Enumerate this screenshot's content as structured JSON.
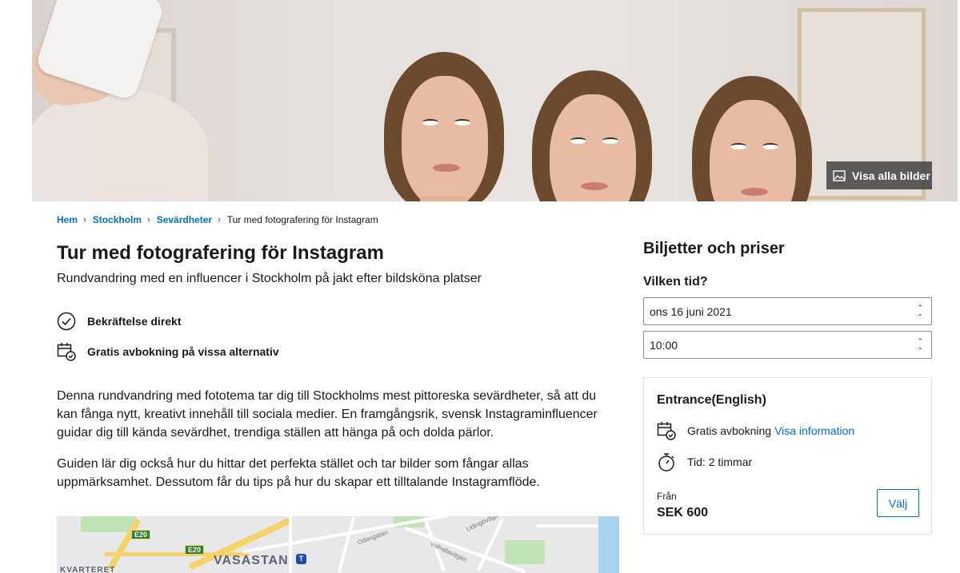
{
  "hero": {
    "view_all_label": "Visa alla bilder"
  },
  "breadcrumb": {
    "items": [
      "Hem",
      "Stockholm",
      "Sevärdheter"
    ],
    "current": "Tur med fotografering för Instagram"
  },
  "attraction": {
    "title": "Tur med fotografering för Instagram",
    "subtitle": "Rundvandring med en influencer i Stockholm på jakt efter bildsköna platser",
    "features": [
      {
        "icon": "check-circle-icon",
        "label": "Bekräftelse direkt"
      },
      {
        "icon": "calendar-check-icon",
        "label": "Gratis avbokning på vissa alternativ"
      }
    ],
    "description": [
      "Denna rundvandring med fototema tar dig till Stockholms mest pittoreska sevärdheter, så att du kan fånga nytt, kreativt innehåll till sociala medier. En framgångsrik, svensk Instagraminfluencer guidar dig till kända sevärdhet, trendiga ställen att hänga på och dolda pärlor.",
      "Guiden lär dig också hur du hittar det perfekta stället och tar bilder som fångar allas uppmärksamhet. Dessutom får du tips på hur du skapar ett tilltalande Instagramflöde."
    ]
  },
  "map": {
    "district_label": "VASASTAN",
    "area_label": "KVARTERET",
    "highway_shields": [
      "E20",
      "E20"
    ],
    "streets": [
      "Odengatan",
      "Valhallavägen",
      "Lidingövägen"
    ]
  },
  "booking": {
    "heading": "Biljetter och priser",
    "question": "Vilken tid?",
    "date_value": "ons 16 juni 2021",
    "time_value": "10:00",
    "ticket": {
      "name": "Entrance(English)",
      "cancellation_label": "Gratis avbokning",
      "info_link": "Visa information",
      "duration_label": "Tid: 2 timmar",
      "from_label": "Från",
      "price": "SEK 600",
      "select_label": "Välj"
    }
  },
  "colors": {
    "link": "#0071c2",
    "text": "#1a1a1a"
  }
}
